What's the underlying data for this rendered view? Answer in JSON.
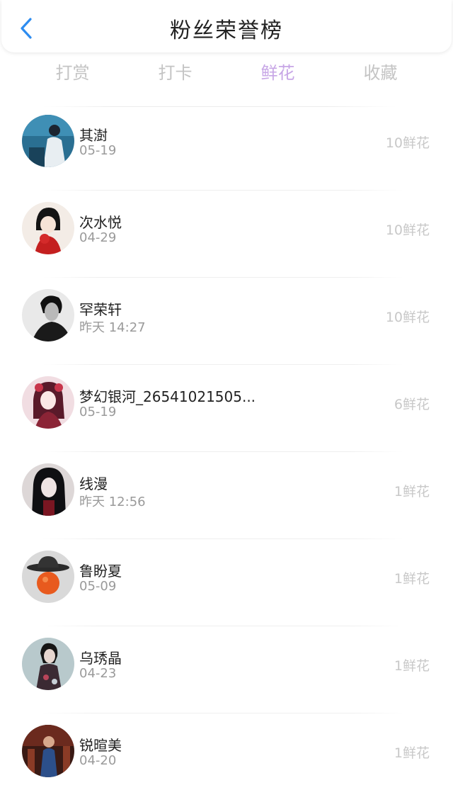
{
  "header": {
    "title": "粉丝荣誉榜",
    "back_icon": "chevron-left-icon",
    "accent": "#2d8cf0"
  },
  "tabs": [
    {
      "label": "打赏",
      "active": false
    },
    {
      "label": "打卡",
      "active": false
    },
    {
      "label": "鲜花",
      "active": true
    },
    {
      "label": "收藏",
      "active": false
    }
  ],
  "active_tab_color": "#c7a6e6",
  "fans": [
    {
      "name": "其澍",
      "time": "05-19",
      "amount": "10鲜花"
    },
    {
      "name": "次水悦",
      "time": "04-29",
      "amount": "10鲜花"
    },
    {
      "name": "罕荣轩",
      "time": "昨天 14:27",
      "amount": "10鲜花"
    },
    {
      "name": "梦幻银河_26541021505...",
      "time": "05-19",
      "amount": "6鲜花"
    },
    {
      "name": "线漫",
      "time": "昨天 12:56",
      "amount": "1鲜花"
    },
    {
      "name": "鲁盼夏",
      "time": "05-09",
      "amount": "1鲜花"
    },
    {
      "name": "乌琇晶",
      "time": "04-23",
      "amount": "1鲜花"
    },
    {
      "name": "锐暄美",
      "time": "04-20",
      "amount": "1鲜花"
    }
  ]
}
